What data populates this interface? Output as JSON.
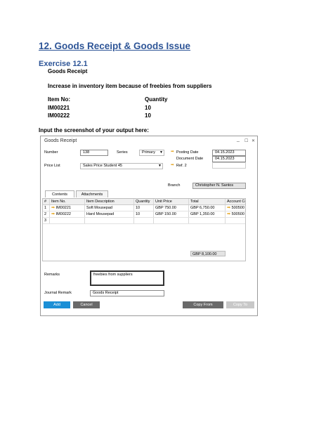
{
  "doc": {
    "heading": "12. Goods Receipt & Goods Issue",
    "exercise": "Exercise 12.1",
    "subtitle": "Goods Receipt",
    "description": "Increase in inventory item because of freebies from suppliers",
    "item_no_header": "Item No:",
    "quantity_header": "Quantity",
    "items": [
      {
        "item": "IM00221",
        "qty": "10"
      },
      {
        "item": "IM00222",
        "qty": "10"
      }
    ],
    "instruction": "Input the screenshot of your output here:"
  },
  "window": {
    "title": "Goods Receipt",
    "controls": {
      "minimize": "_",
      "maximize": "☐",
      "close": "✕"
    },
    "number_label": "Number",
    "number_value": "138",
    "series_label": "Series",
    "series_value": "Primary",
    "posting_date_label": "Posting Date",
    "posting_date_value": "04.15.2023",
    "document_date_label": "Document Date",
    "document_date_value": "04.15.2023",
    "ref2_label": "Ref. 2",
    "price_list_label": "Price List",
    "price_list_value": "Sales Price Student 45",
    "branch_label": "Branch",
    "branch_value": "Christopher N. Santos",
    "tabs": [
      "Contents",
      "Attachments"
    ],
    "columns": [
      "#",
      "Item No.",
      "Item Description",
      "Quantity",
      "Unit Price",
      "Total",
      "Account Co"
    ],
    "rows": [
      {
        "num": "1",
        "item": "IM00221",
        "desc": "Soft Mousepad",
        "qty": "10",
        "price": "GBP 750.00",
        "total": "GBP 6,750.00",
        "account": "500500"
      },
      {
        "num": "2",
        "item": "IM00222",
        "desc": "Hard Mousepad",
        "qty": "10",
        "price": "GBP 150.00",
        "total": "GBP 1,350.00",
        "account": "500500"
      },
      {
        "num": "3",
        "item": "",
        "desc": "",
        "qty": "",
        "price": "",
        "total": "",
        "account": ""
      }
    ],
    "grand_total": "GBP 8,100.00",
    "remarks_label": "Remarks",
    "remarks_value": "freebies from suppliers",
    "journal_remark_label": "Journal Remark",
    "journal_remark_value": "Goods Receipt",
    "buttons": {
      "add": "Add",
      "cancel": "Cancel",
      "copy_from": "Copy From",
      "copy_to": "Copy To"
    },
    "colors": {
      "add": "#1b8fd6",
      "cancel": "#6a6a6a",
      "copy_from": "#6a6a6a",
      "copy_to": "#c8c8c8",
      "branch_bg": "#d6d6d6"
    }
  }
}
